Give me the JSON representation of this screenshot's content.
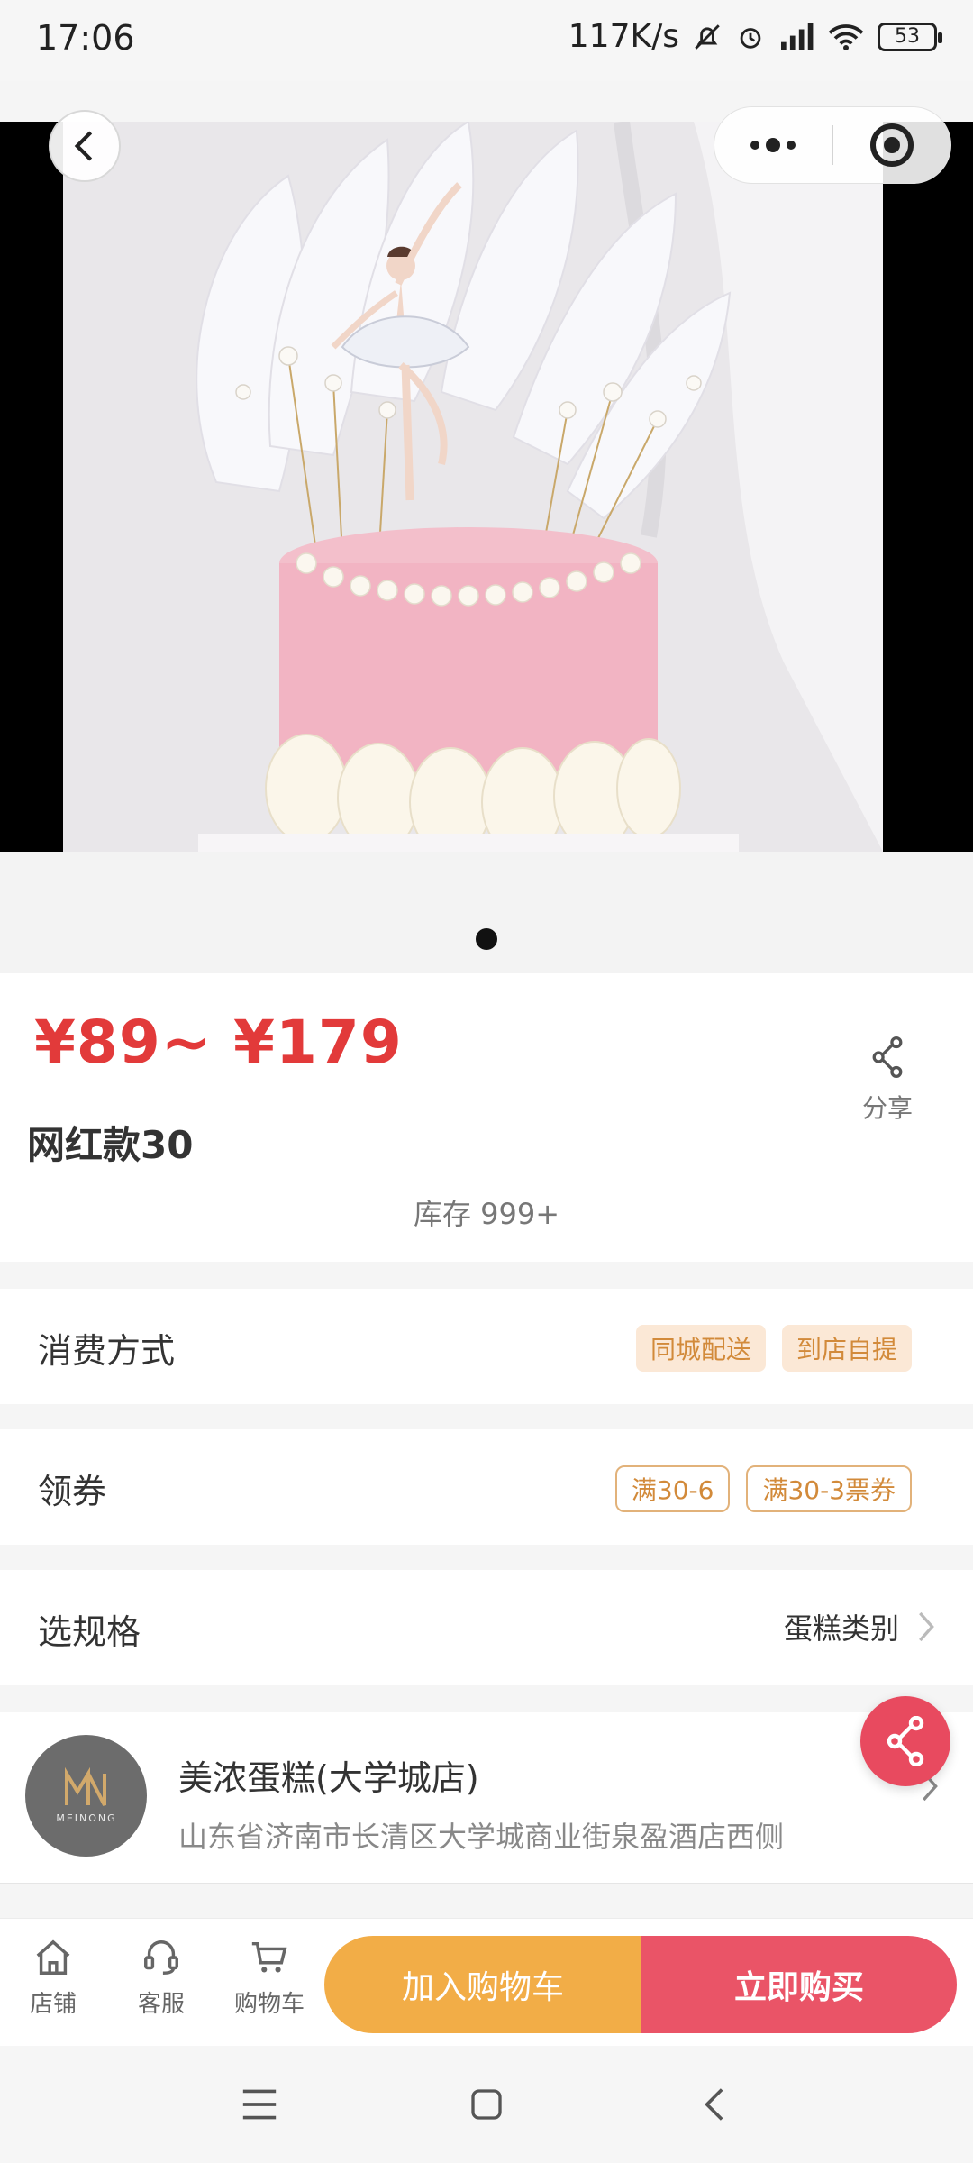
{
  "status_bar": {
    "time": "17:06",
    "net_speed": "117K/s",
    "battery": "53"
  },
  "product": {
    "price_range": "¥89~ ¥179",
    "title": "网红款30",
    "stock": "库存 999+",
    "share_label": "分享",
    "image_pager": {
      "current": 1,
      "total": 1
    }
  },
  "consumption": {
    "label": "消费方式",
    "options": [
      "同城配送",
      "到店自提"
    ]
  },
  "coupons": {
    "label": "领券",
    "items": [
      "满30-6",
      "满30-3票券"
    ]
  },
  "spec": {
    "label": "选规格",
    "value": "蛋糕类别"
  },
  "store": {
    "name": "美浓蛋糕(大学城店)",
    "address": "山东省济南市长清区大学城商业街泉盈酒店西侧",
    "logo_text": "MEINONG"
  },
  "bottom_nav": {
    "shop": "店铺",
    "service": "客服",
    "cart": "购物车",
    "add_to_cart": "加入购物车",
    "buy_now": "立即购买"
  },
  "colors": {
    "price_red": "#e23a3a",
    "cart_orange": "#f2ad47",
    "buy_red": "#ea5467",
    "tag_orange": "#d28a3a"
  }
}
